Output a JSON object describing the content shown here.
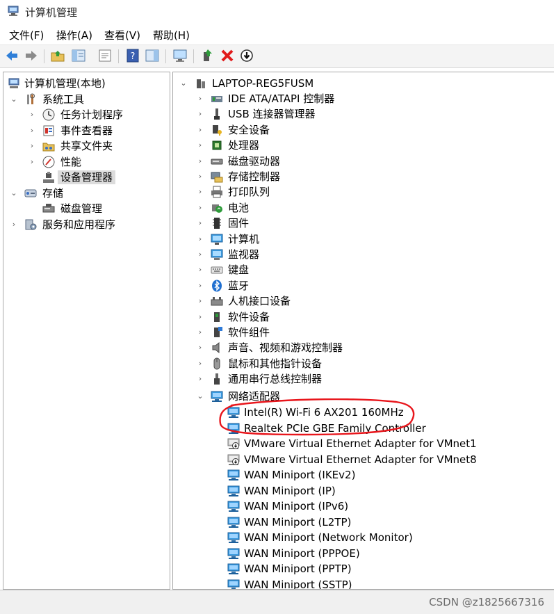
{
  "window": {
    "title": "计算机管理",
    "icon": "computer-management-icon"
  },
  "menu": {
    "items": [
      "文件(F)",
      "操作(A)",
      "查看(V)",
      "帮助(H)"
    ]
  },
  "toolbar": {
    "buttons": [
      "back-arrow-icon",
      "forward-arrow-icon",
      "up-folder-icon",
      "show-hide-tree-icon",
      "properties-icon",
      "help-icon",
      "action-pane-icon",
      "monitor-icon",
      "update-driver-icon",
      "uninstall-icon",
      "scan-changes-icon"
    ]
  },
  "left_tree": {
    "items": [
      {
        "label": "计算机管理(本地)",
        "icon": "computer-management-icon",
        "chevron": ""
      },
      {
        "label": "系统工具",
        "icon": "tools-icon",
        "chevron": "⌄"
      },
      {
        "label": "任务计划程序",
        "icon": "clock-icon",
        "chevron": "›"
      },
      {
        "label": "事件查看器",
        "icon": "event-viewer-icon",
        "chevron": "›"
      },
      {
        "label": "共享文件夹",
        "icon": "shared-folder-icon",
        "chevron": "›"
      },
      {
        "label": "性能",
        "icon": "performance-icon",
        "chevron": "›"
      },
      {
        "label": "设备管理器",
        "icon": "device-manager-icon",
        "chevron": "",
        "selected": true
      },
      {
        "label": "存储",
        "icon": "storage-icon",
        "chevron": "⌄"
      },
      {
        "label": "磁盘管理",
        "icon": "disk-icon",
        "chevron": ""
      },
      {
        "label": "服务和应用程序",
        "icon": "services-icon",
        "chevron": "›"
      }
    ]
  },
  "device_tree": {
    "root": {
      "label": "LAPTOP-REG5FUSM",
      "chevron": "⌄",
      "icon": "computer-tower-icon"
    },
    "categories": [
      {
        "label": "IDE ATA/ATAPI 控制器",
        "icon": "ide-controller-icon"
      },
      {
        "label": "USB 连接器管理器",
        "icon": "usb-icon"
      },
      {
        "label": "安全设备",
        "icon": "security-key-icon"
      },
      {
        "label": "处理器",
        "icon": "processor-icon"
      },
      {
        "label": "磁盘驱动器",
        "icon": "disk-drive-icon"
      },
      {
        "label": "存储控制器",
        "icon": "storage-controller-icon"
      },
      {
        "label": "打印队列",
        "icon": "printer-icon"
      },
      {
        "label": "电池",
        "icon": "battery-icon"
      },
      {
        "label": "固件",
        "icon": "firmware-icon"
      },
      {
        "label": "计算机",
        "icon": "computer-icon"
      },
      {
        "label": "监视器",
        "icon": "monitor-icon"
      },
      {
        "label": "键盘",
        "icon": "keyboard-icon"
      },
      {
        "label": "蓝牙",
        "icon": "bluetooth-icon"
      },
      {
        "label": "人机接口设备",
        "icon": "hid-icon"
      },
      {
        "label": "软件设备",
        "icon": "software-device-icon"
      },
      {
        "label": "软件组件",
        "icon": "software-component-icon"
      },
      {
        "label": "声音、视频和游戏控制器",
        "icon": "speaker-icon"
      },
      {
        "label": "鼠标和其他指针设备",
        "icon": "mouse-icon"
      },
      {
        "label": "通用串行总线控制器",
        "icon": "usb-controller-icon"
      }
    ],
    "network_adapters": {
      "label": "网络适配器",
      "icon": "network-adapter-icon",
      "chevron": "⌄",
      "children": [
        {
          "label": "Intel(R) Wi-Fi 6 AX201 160MHz",
          "icon": "network-adapter-icon"
        },
        {
          "label": "Realtek PCIe GBE Family Controller",
          "icon": "network-adapter-icon"
        },
        {
          "label": "VMware Virtual Ethernet Adapter for VMnet1",
          "icon": "network-adapter-disabled-icon"
        },
        {
          "label": "VMware Virtual Ethernet Adapter for VMnet8",
          "icon": "network-adapter-disabled-icon"
        },
        {
          "label": "WAN Miniport (IKEv2)",
          "icon": "network-adapter-icon"
        },
        {
          "label": "WAN Miniport (IP)",
          "icon": "network-adapter-icon"
        },
        {
          "label": "WAN Miniport (IPv6)",
          "icon": "network-adapter-icon"
        },
        {
          "label": "WAN Miniport (L2TP)",
          "icon": "network-adapter-icon"
        },
        {
          "label": "WAN Miniport (Network Monitor)",
          "icon": "network-adapter-icon"
        },
        {
          "label": "WAN Miniport (PPPOE)",
          "icon": "network-adapter-icon"
        },
        {
          "label": "WAN Miniport (PPTP)",
          "icon": "network-adapter-icon"
        },
        {
          "label": "WAN Miniport (SSTP)",
          "icon": "network-adapter-icon"
        }
      ]
    },
    "collapsed_chevron": "›"
  },
  "annotation": {
    "color": "#e8151b"
  },
  "statusbar": {
    "watermark": "CSDN @z1825667316"
  },
  "colors": {
    "accent": "#1e6fd0",
    "selection": "#dcdcdc"
  }
}
